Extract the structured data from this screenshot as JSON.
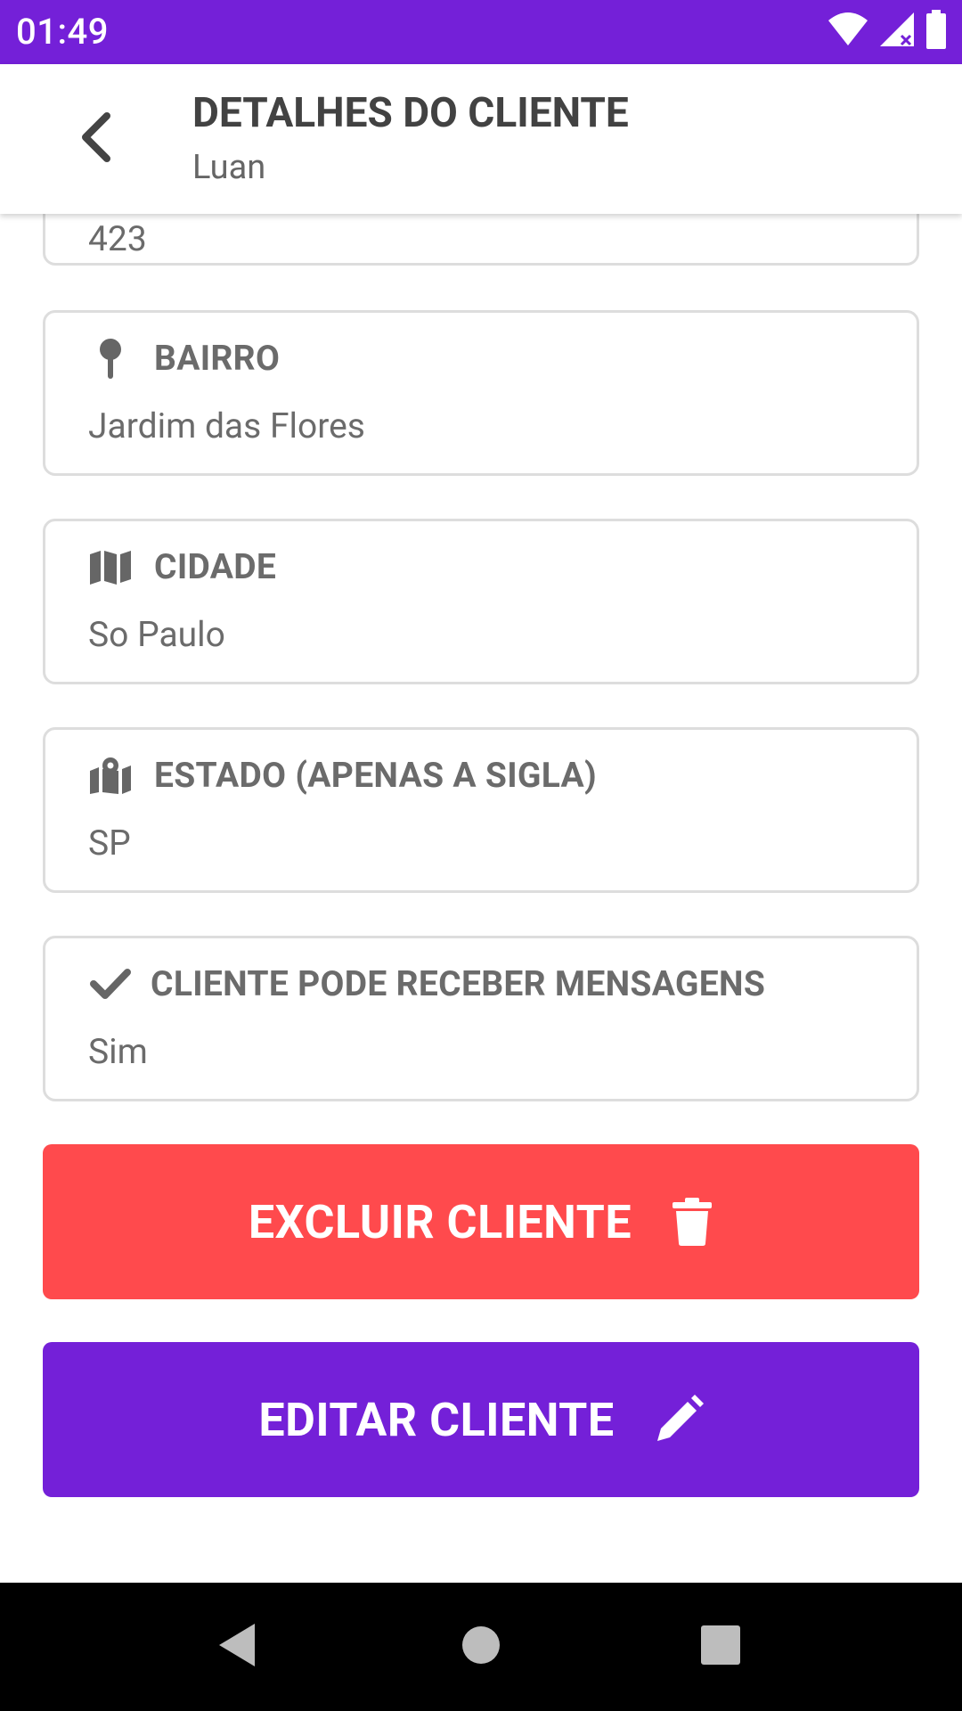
{
  "status_bar": {
    "time": "01:49",
    "icons": [
      "wifi-icon",
      "signal-icon",
      "battery-icon"
    ],
    "background": "#7420d8"
  },
  "app_bar": {
    "title": "DETALHES DO CLIENTE",
    "subtitle": "Luan",
    "back_icon": "chevron-left-icon"
  },
  "partial_field": {
    "value": "423"
  },
  "fields": [
    {
      "icon": "pin-icon",
      "label": "BAIRRO",
      "value": "Jardim das Flores"
    },
    {
      "icon": "map-icon",
      "label": "CIDADE",
      "value": "So Paulo"
    },
    {
      "icon": "map-marker-icon",
      "label": "ESTADO (APENAS A SIGLA)",
      "value": "SP"
    },
    {
      "icon": "check-icon",
      "label": "CLIENTE PODE RECEBER MENSAGENS",
      "value": "Sim"
    }
  ],
  "buttons": {
    "delete_label": "EXCLUIR CLIENTE",
    "delete_icon": "trash-icon",
    "delete_color": "#ff4a4d",
    "edit_label": "EDITAR CLIENTE",
    "edit_icon": "pencil-icon",
    "edit_color": "#7420d8"
  },
  "nav_bar": {
    "back": "nav-back-icon",
    "home": "nav-home-icon",
    "recents": "nav-recents-icon"
  }
}
